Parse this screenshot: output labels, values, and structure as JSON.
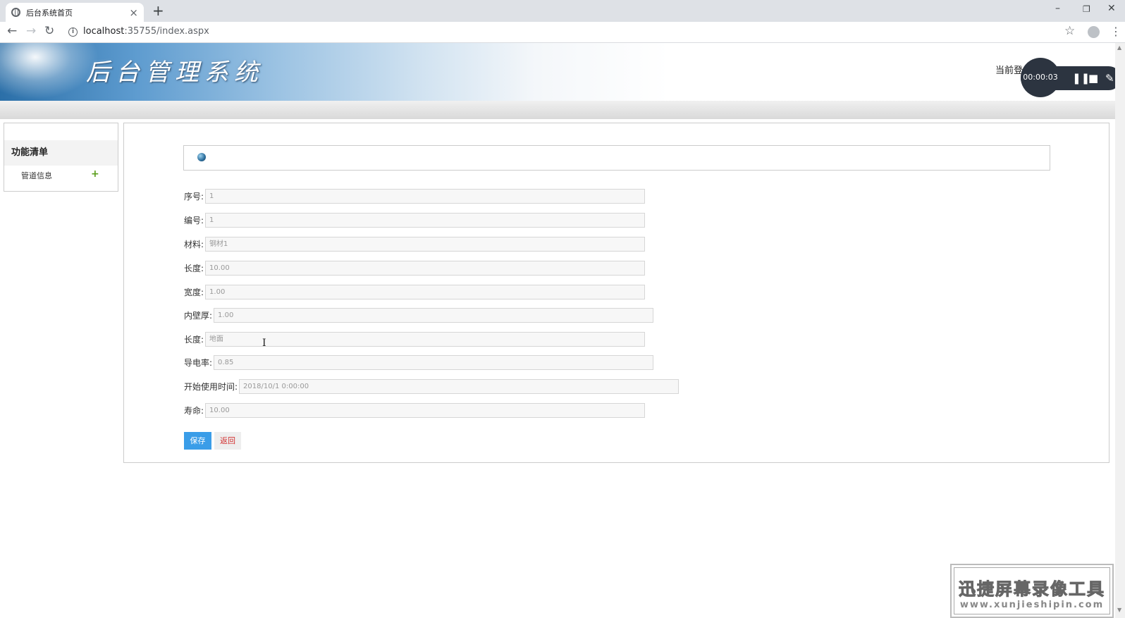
{
  "browser": {
    "tab_title": "后台系统首页",
    "tab_close": "×",
    "new_tab": "+",
    "minimize": "–",
    "restore": "❐",
    "close": "✕",
    "url_host": "localhost",
    "url_path": ":35755/index.aspx"
  },
  "header": {
    "title": "后台管理系统",
    "login_info": "当前登"
  },
  "recorder": {
    "timer": "00:00:03"
  },
  "sidebar": {
    "heading": "功能清单",
    "items": [
      {
        "label": "管道信息",
        "expand": "+"
      }
    ]
  },
  "form": {
    "fields": [
      {
        "label": "序号:",
        "value": "1"
      },
      {
        "label": "编号:",
        "value": "1"
      },
      {
        "label": "材料:",
        "value": "钢材1"
      },
      {
        "label": "长度:",
        "value": "10.00"
      },
      {
        "label": "宽度:",
        "value": "1.00"
      },
      {
        "label": "内壁厚:",
        "value": "1.00"
      },
      {
        "label": "长度:",
        "value": "地面"
      },
      {
        "label": "导电率:",
        "value": "0.85"
      },
      {
        "label": "开始使用时间:",
        "value": "2018/10/1 0:00:00"
      },
      {
        "label": "寿命:",
        "value": "10.00"
      }
    ],
    "save_label": "保存",
    "back_label": "返回"
  },
  "watermark": {
    "main": "迅捷屏幕录像工具",
    "sub": "www.xunjieshipin.com"
  }
}
